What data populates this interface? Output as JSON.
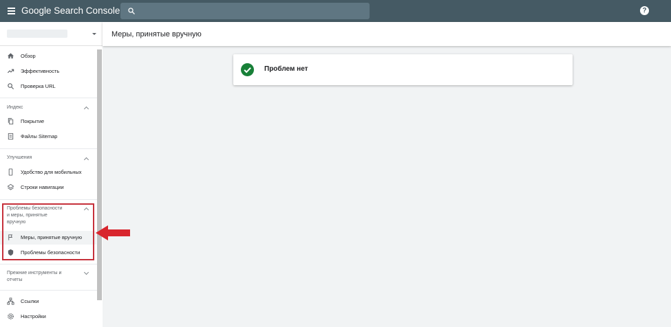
{
  "header": {
    "app_title": "Google Search Console",
    "search_placeholder": "",
    "help_label": "?"
  },
  "sidebar": {
    "top_items": [
      {
        "label": "Обзор",
        "icon": "home-icon"
      },
      {
        "label": "Эффективность",
        "icon": "trending-icon"
      },
      {
        "label": "Проверка URL",
        "icon": "search-icon"
      }
    ],
    "sections": [
      {
        "title": "Индекс",
        "expanded": true,
        "items": [
          {
            "label": "Покрытие",
            "icon": "file-copy-icon"
          },
          {
            "label": "Файлы Sitemap",
            "icon": "sitemap-icon"
          }
        ]
      },
      {
        "title": "Улучшения",
        "expanded": true,
        "items": [
          {
            "label": "Удобство для мобильных",
            "icon": "phone-icon"
          },
          {
            "label": "Строки навигации",
            "icon": "layers-icon"
          }
        ]
      },
      {
        "title": "Проблемы безопасности и меры, принятые вручную",
        "title_lines": [
          "Проблемы безопасности",
          "и меры, принятые",
          "вручную"
        ],
        "expanded": true,
        "items": [
          {
            "label": "Меры, принятые вручную",
            "icon": "flag-icon",
            "active": true
          },
          {
            "label": "Проблемы безопасности",
            "icon": "shield-icon"
          }
        ]
      },
      {
        "title": "Прежние инструменты и отчеты",
        "title_lines": [
          "Прежние инструменты и",
          "отчеты"
        ],
        "expanded": false,
        "items": []
      }
    ],
    "bottom_items": [
      {
        "label": "Ссылки",
        "icon": "links-icon"
      },
      {
        "label": "Настройки",
        "icon": "gear-icon"
      }
    ]
  },
  "main": {
    "page_title": "Меры, принятые вручную",
    "result_text": "Проблем нет"
  },
  "colors": {
    "topbar": "#455a64",
    "highlight": "#c6303a",
    "success": "#188038"
  }
}
